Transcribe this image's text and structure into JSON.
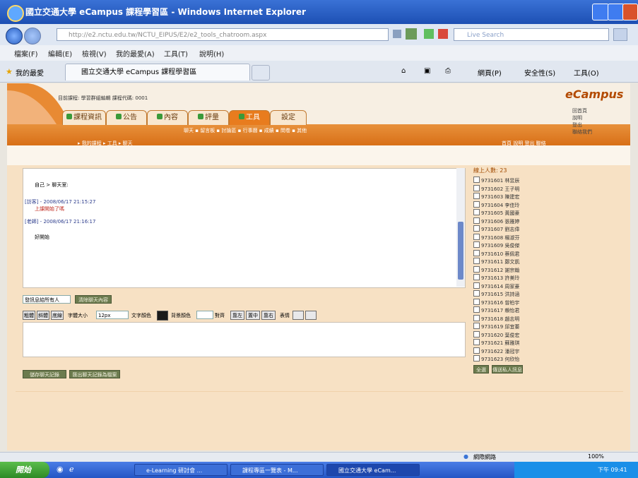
{
  "window": {
    "title": "國立交通大學 eCampus 課程學習區 - Windows Internet Explorer"
  },
  "address": {
    "url": "http://e2.nctu.edu.tw/NCTU_EIPUS/E2/e2_tools_chatroom.aspx",
    "search_placeholder": "Live Search"
  },
  "menu": [
    "檔案(F)",
    "編輯(E)",
    "檢視(V)",
    "我的最愛(A)",
    "工具(T)",
    "說明(H)"
  ],
  "favbar": {
    "favorites": "我的最愛",
    "tab": "國立交通大學 eCampus 課程學習區",
    "tools": [
      "網頁(P)",
      "安全性(S)",
      "工具(O)"
    ]
  },
  "page": {
    "logo": "eCampus",
    "userline": "目前課程: 學習群組編輯 課程代碼: 0001",
    "nav_tabs": [
      "課程資訊",
      "公告",
      "內容",
      "評量",
      "工具",
      "設定"
    ],
    "subnav": "聊天 ▪ 留言板 ▪ 討論區 ▪ 行事曆 ▪ 成績 ▪ 問卷 ▪ 其他",
    "crumb": "▸ 我的課程 ▸ 工具 ▸ 聊天",
    "rightlinks": "首頁 說明 登出 聯絡",
    "top_options": [
      "回首頁",
      "說明",
      "登出",
      "聯絡我們"
    ],
    "chat": {
      "title": "自己 > 聊天室:",
      "line1": "[訪客] - 2008/06/17 21:15:27",
      "line1b": "上課開始了嗎",
      "line2": "[老師] - 2008/06/17 21:16:17",
      "line3": "好開始"
    },
    "controls": {
      "recipient": "發訊息給所有人",
      "clear_btn": "清除聊天內容",
      "fmt_buttons": [
        "粗體",
        "斜體",
        "底線"
      ],
      "font_label": "字體大小",
      "font_value": "12px",
      "color_label": "文字顏色",
      "bg_label": "背景顏色",
      "align_label": "對齊",
      "align_buttons": [
        "靠左",
        "置中",
        "靠右"
      ],
      "emoticon_label": "表情",
      "save_btn": "儲存聊天記錄",
      "export_btn": "匯出聊天記錄為檔案"
    },
    "userlist": {
      "header": "線上人數: 23",
      "users": [
        "9731601 林昱辰",
        "9731602 王子明",
        "9731603 陳建宏",
        "9731604 李佳玲",
        "9731605 黃國豪",
        "9731606 張雅婷",
        "9731607 劉志偉",
        "9731608 楊淑芬",
        "9731609 吳俊傑",
        "9731610 蔡佩君",
        "9731611 鄭文凱",
        "9731612 謝宗翰",
        "9731613 許美玲",
        "9731614 周家豪",
        "9731615 洪詩涵",
        "9731616 曾柏宇",
        "9731617 賴怡君",
        "9731618 趙志明",
        "9731619 邱宜蓁",
        "9731620 葉俊宏",
        "9731621 蘇雅琪",
        "9731622 潘冠宇",
        "9731623 何欣怡"
      ],
      "btn1": "全選",
      "btn2": "傳送私人訊息"
    }
  },
  "status": {
    "zone": "網際網路",
    "zoom": "100%"
  },
  "taskbar": {
    "start": "開始",
    "tasks": [
      "e-Learning 研討會 ...",
      "課程專區一覽表 - M...",
      "國立交通大學 eCam..."
    ],
    "time": "下午 09:41"
  }
}
